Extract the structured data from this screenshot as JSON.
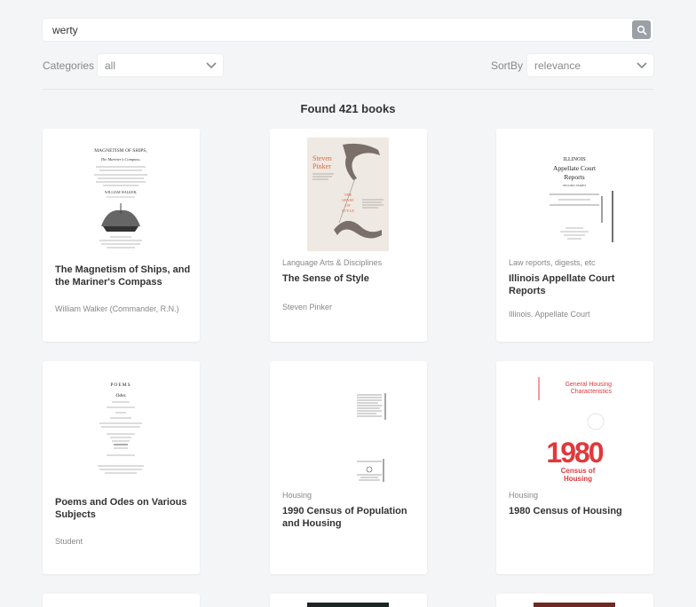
{
  "search": {
    "value": "werty"
  },
  "filters": {
    "categories_label": "Categories",
    "categories_value": "all",
    "sortby_label": "SortBy",
    "sortby_value": "relevance"
  },
  "results": {
    "found_text": "Found 421 books"
  },
  "books": [
    {
      "title": "The Magnetism of Ships, and the Mariner's Compass",
      "category": "",
      "author": "William Walker (Commander, R.N.)",
      "cover": {
        "title_lines": [
          "MAGNETISM OF SHIPS,",
          "The Mariner's Compass;"
        ],
        "author_line": "WILLIAM WALKER,"
      }
    },
    {
      "title": "The Sense of Style",
      "category": "Language Arts & Disciplines",
      "author": "Steven Pinker",
      "cover": {
        "author_lines": [
          "Steven",
          "Pinker"
        ],
        "title_lines": [
          "THE",
          "SENSE",
          "OF",
          "STYLE"
        ]
      }
    },
    {
      "title": "Illinois Appellate Court Reports",
      "category": "Law reports, digests, etc",
      "author": "Illinois. Appellate Court",
      "cover": {
        "title_lines": [
          "ILLINOIS",
          "Appellate Court",
          "Reports"
        ],
        "subtitle": "SECOND SERIES"
      }
    },
    {
      "title": "Poems and Odes on Various Subjects",
      "category": "",
      "author": "Student",
      "cover": {
        "title_lines": [
          "POEMS",
          "Odes"
        ]
      }
    },
    {
      "title": "1990 Census of Population and Housing",
      "category": "Housing",
      "author": "",
      "cover": {}
    },
    {
      "title": "1980 Census of Housing",
      "category": "Housing",
      "author": "",
      "cover": {
        "header_lines": [
          "General Housing",
          "Characteristics"
        ],
        "big_number": "1980",
        "footer_lines": [
          "Census of",
          "Housing"
        ]
      }
    }
  ]
}
